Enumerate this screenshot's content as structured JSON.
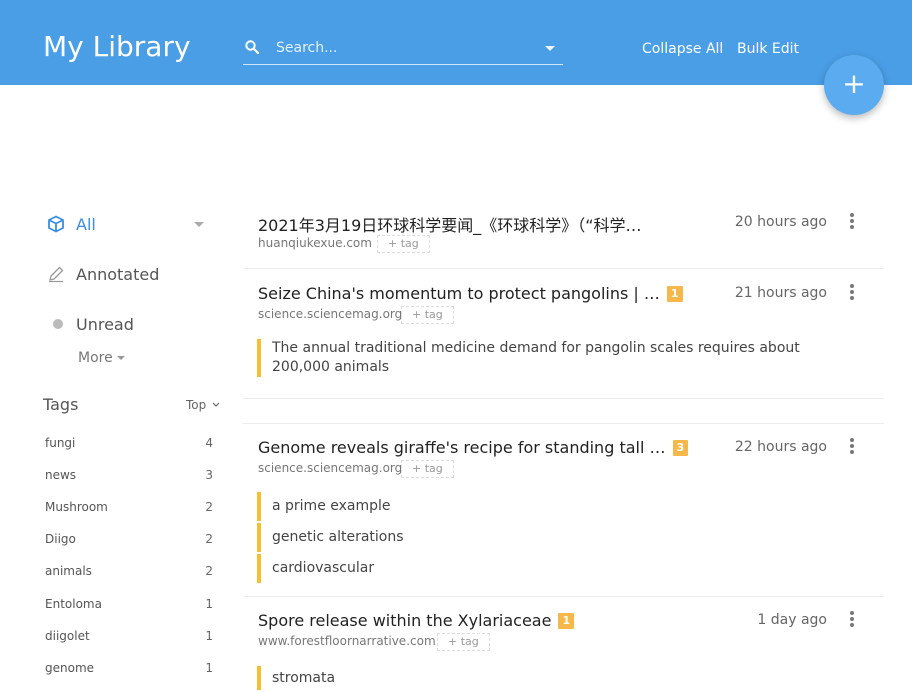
{
  "header": {
    "title": "My Library",
    "search_placeholder": "Search...",
    "collapse_all": "Collapse All",
    "bulk_edit": "Bulk Edit",
    "fab_label": "+",
    "accent_color": "#4a9ee6"
  },
  "sidebar": {
    "nav": [
      {
        "label": "All",
        "icon": "cube-icon",
        "active": true
      },
      {
        "label": "Annotated",
        "icon": "pencil-icon"
      },
      {
        "label": "Unread",
        "icon": "dot-icon"
      }
    ],
    "more_label": "More",
    "tags_title": "Tags",
    "tags_sort": "Top",
    "tags": [
      {
        "name": "fungi",
        "count": "4"
      },
      {
        "name": "news",
        "count": "3"
      },
      {
        "name": "Mushroom",
        "count": "2"
      },
      {
        "name": "Diigo",
        "count": "2"
      },
      {
        "name": "animals",
        "count": "2"
      },
      {
        "name": "Entoloma",
        "count": "1"
      },
      {
        "name": "diigolet",
        "count": "1"
      },
      {
        "name": "genome",
        "count": "1"
      }
    ]
  },
  "items": [
    {
      "title": "2021年3月19日环球科学要闻_《环球科学》（“科学…",
      "time": "20 hours ago",
      "domain": "huanqiukexue.com",
      "add_tag": "+ tag"
    },
    {
      "title": "Seize China's momentum to protect pangolins | …",
      "badge": "1",
      "time": "21 hours ago",
      "domain": "science.sciencemag.org",
      "add_tag": "+ tag",
      "highlights": [
        "The annual traditional medicine demand for pangolin scales requires about 200,000 animals"
      ]
    },
    {
      "title": "Genome reveals giraffe's recipe for standing tall …",
      "badge": "3",
      "time": "22 hours ago",
      "domain": "science.sciencemag.org",
      "add_tag": "+ tag",
      "highlights": [
        "a prime example",
        "genetic alterations",
        "cardiovascular"
      ]
    },
    {
      "title": "Spore release within the Xylariaceae",
      "badge": "1",
      "time": "1 day ago",
      "domain": "www.forestfloornarrative.com",
      "add_tag": "+ tag",
      "highlights": [
        "stromata"
      ]
    }
  ]
}
